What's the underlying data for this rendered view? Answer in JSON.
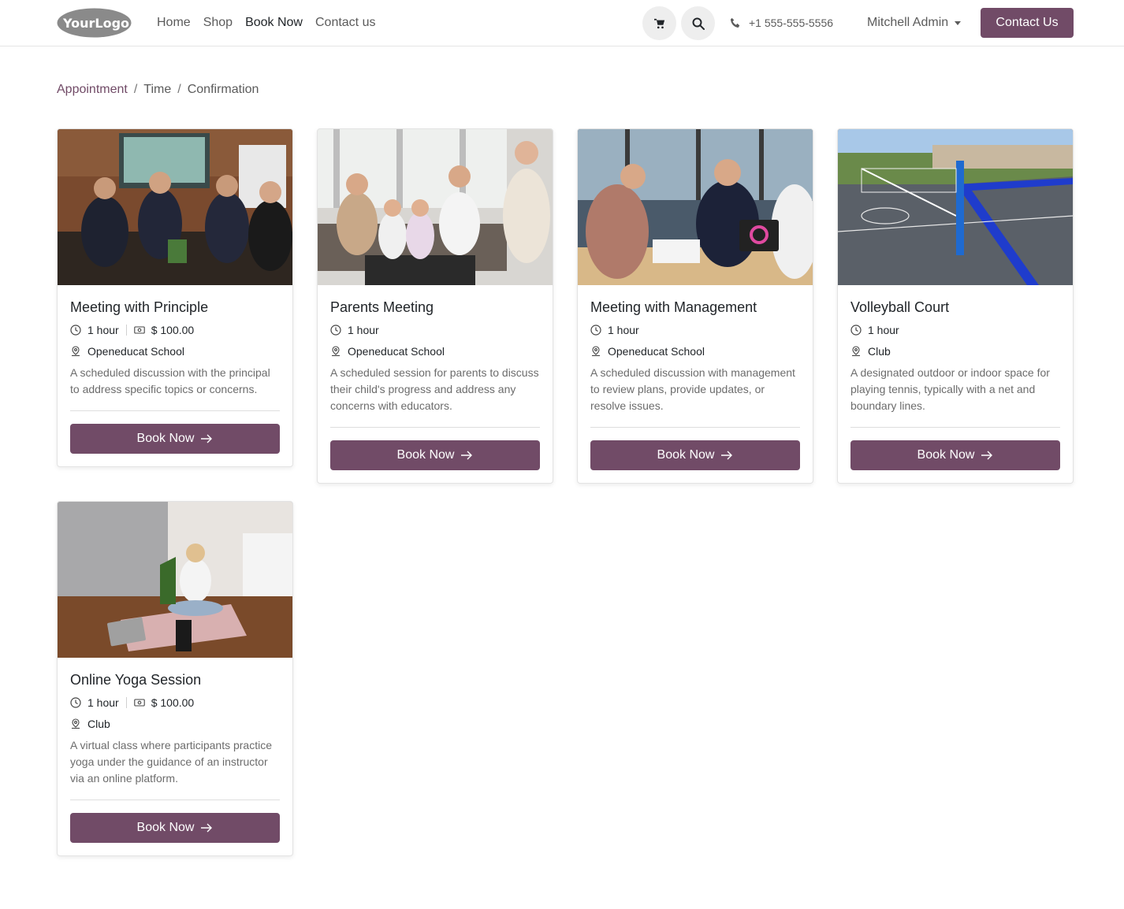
{
  "header": {
    "logo_text": "YourLogo",
    "nav": [
      {
        "label": "Home"
      },
      {
        "label": "Shop"
      },
      {
        "label": "Book Now"
      },
      {
        "label": "Contact us"
      }
    ],
    "phone": "+1 555-555-5556",
    "user": "Mitchell Admin",
    "contact_button": "Contact Us"
  },
  "breadcrumb": {
    "items": [
      "Appointment",
      "Time",
      "Confirmation"
    ],
    "separator": "/"
  },
  "cards": [
    {
      "title": "Meeting with Principle",
      "duration": "1 hour",
      "price": "$ 100.00",
      "location": "Openeducat School",
      "description": "A scheduled discussion with the principal to address specific topics or concerns.",
      "button": "Book Now"
    },
    {
      "title": "Parents Meeting",
      "duration": "1 hour",
      "location": "Openeducat School",
      "description": "A scheduled session for parents to discuss their child's progress and address any concerns with educators.",
      "button": "Book Now"
    },
    {
      "title": "Meeting with Management",
      "duration": "1 hour",
      "location": "Openeducat School",
      "description": "A scheduled discussion with management to review plans, provide updates, or resolve issues.",
      "button": "Book Now"
    },
    {
      "title": "Volleyball Court",
      "duration": "1 hour",
      "location": "Club",
      "description": "A designated outdoor or indoor space for playing tennis, typically with a net and boundary lines.",
      "button": "Book Now"
    },
    {
      "title": "Online Yoga Session",
      "duration": "1 hour",
      "price": "$ 100.00",
      "location": "Club",
      "description": "A virtual class where participants practice yoga under the guidance of an instructor via an online platform.",
      "button": "Book Now"
    }
  ],
  "colors": {
    "brand": "#714b67"
  }
}
